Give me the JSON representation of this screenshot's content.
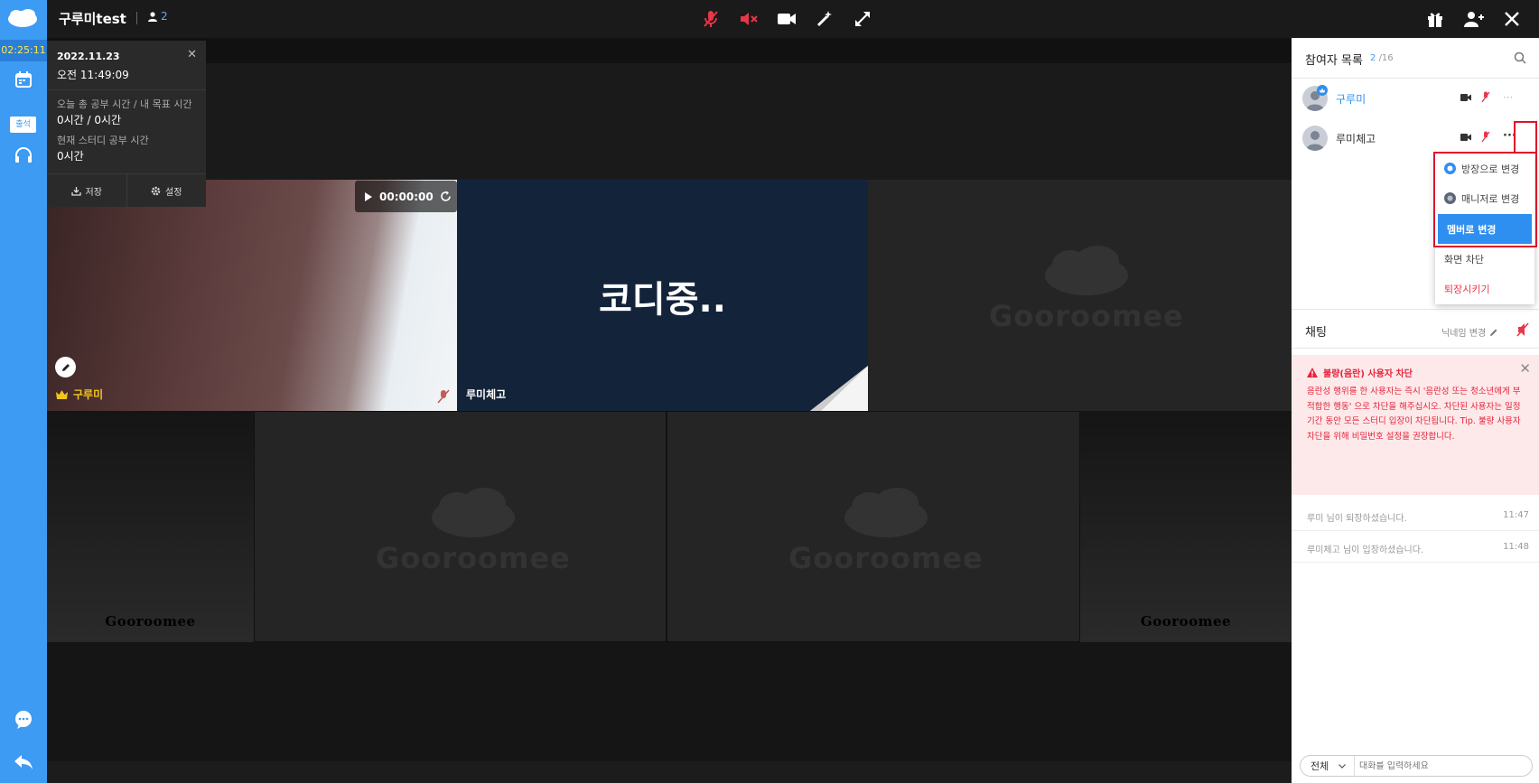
{
  "rail": {
    "timer": "02:25:11",
    "attend_label": "출석"
  },
  "header": {
    "room_title": "구루미test",
    "user_count": "2"
  },
  "info_panel": {
    "date": "2022.11.23",
    "time": "오전 11:49:09",
    "today_label": "오늘 총 공부 시간 / 내 목표 시간",
    "today_value": "0시간 / 0시간",
    "current_label": "현재 스터디 공부 시간",
    "current_value": "0시간",
    "save_label": "저장",
    "settings_label": "설정"
  },
  "videos": {
    "tile1_name": "구루미",
    "tile1_timer": "00:00:00",
    "tile2_text": "코디중..",
    "tile2_name": "루미체고",
    "watermark": "Gooroomee"
  },
  "participants": {
    "title": "참여자 목록",
    "count": "2",
    "max": "/16",
    "rows": [
      {
        "name": "구루미"
      },
      {
        "name": "루미체고"
      }
    ]
  },
  "context_menu": {
    "items": [
      {
        "label": "방장으로 변경"
      },
      {
        "label": "매니저로 변경"
      },
      {
        "label": "멤버로 변경"
      },
      {
        "label": "화면 차단"
      },
      {
        "label": "퇴장시키기"
      }
    ]
  },
  "chat": {
    "title": "채팅",
    "nick_change": "닉네임 변경",
    "warning_title": "불량(음란) 사용자 차단",
    "warning_body": "음란성 행위를 한 사용자는 즉시 '음란성 또는 청소년에게 부적합한 행동' 으로 차단을 해주십시오. 차단된 사용자는 일정 기간 동안 모든 스터디 입장이 차단됩니다. Tip. 불량 사용자 차단을 위해 비밀번호 설정을 권장합니다.",
    "messages": [
      {
        "text": "루미 님이 퇴장하셨습니다.",
        "time": "11:47"
      },
      {
        "text": "루미체고 님이 입장하셨습니다.",
        "time": "11:48"
      }
    ],
    "scope": "전체",
    "placeholder": "대화를 입력하세요"
  },
  "colors": {
    "rail": "#3d9bf3",
    "accent_blue": "#2f8ff0",
    "warning_red": "#e5233a",
    "highlight_box": "#e0142a",
    "gold": "#f2c51a"
  }
}
